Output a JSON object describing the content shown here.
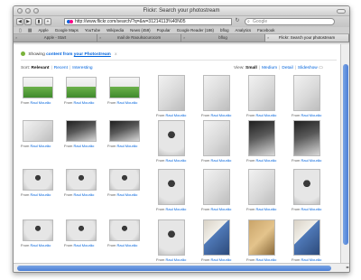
{
  "window": {
    "title": "Flickr: Search your photostream"
  },
  "toolbar": {
    "back": "◀",
    "forward": "▶",
    "url": "http://www.flickr.com/search/?q=&w=31214113%40N05",
    "search_placeholder": "Google"
  },
  "bookmarks": [
    "Apple",
    "Google Maps",
    "YouTube",
    "Wikipedia",
    "News (459)",
    "Popular",
    "Google Reader (186)",
    "bflog",
    "Analytics",
    "Facebook"
  ],
  "tabs": [
    {
      "label": "Apple - Start",
      "active": false
    },
    {
      "label": "mail de Raoulsocurocom",
      "active": false
    },
    {
      "label": "bflog",
      "active": false
    },
    {
      "label": "Flickr: Search your photostream",
      "active": true
    }
  ],
  "filter": {
    "prefix": "Showing",
    "content_label": "content from",
    "source_link": "your Photostream",
    "close": "x"
  },
  "sort": {
    "label": "Sort:",
    "options": [
      "Relevant",
      "Recent",
      "Interesting"
    ],
    "selected": "Relevant"
  },
  "view": {
    "label": "View:",
    "options": [
      "Small",
      "Medium",
      "Detail",
      "Slideshow"
    ],
    "selected": "Small"
  },
  "photos": {
    "caption_prefix": "From",
    "owner": "Raul Mourão",
    "rows": [
      [
        {
          "tone": "green"
        },
        {
          "tone": "green"
        },
        {
          "tone": "green"
        },
        {
          "tone": "gallery"
        },
        {
          "tone": "gallery"
        },
        {
          "tone": "gallery"
        },
        {
          "tone": "gallery"
        }
      ],
      [
        {
          "tone": "gallery"
        },
        {
          "tone": "dark"
        },
        {
          "tone": "dark"
        },
        {
          "tone": "bw"
        },
        {
          "tone": "gallery"
        },
        {
          "tone": "dark"
        },
        {
          "tone": "dark"
        }
      ],
      [
        {
          "tone": "bw"
        },
        {
          "tone": "bw"
        },
        {
          "tone": "bw"
        },
        {
          "tone": "bw"
        },
        {
          "tone": "gallery"
        },
        {
          "tone": "gallery"
        },
        {
          "tone": "bw"
        }
      ],
      [
        {
          "tone": "bw"
        },
        {
          "tone": "bw"
        },
        {
          "tone": "bw"
        },
        {
          "tone": "bw"
        },
        {
          "tone": "color"
        },
        {
          "tone": "wood"
        },
        {
          "tone": "color"
        }
      ]
    ]
  },
  "colors": {
    "link": "#0063dc",
    "scroll_thumb": "#4b7fd6",
    "flickr_pink": "#ff0084",
    "flickr_blue": "#0063dc"
  }
}
